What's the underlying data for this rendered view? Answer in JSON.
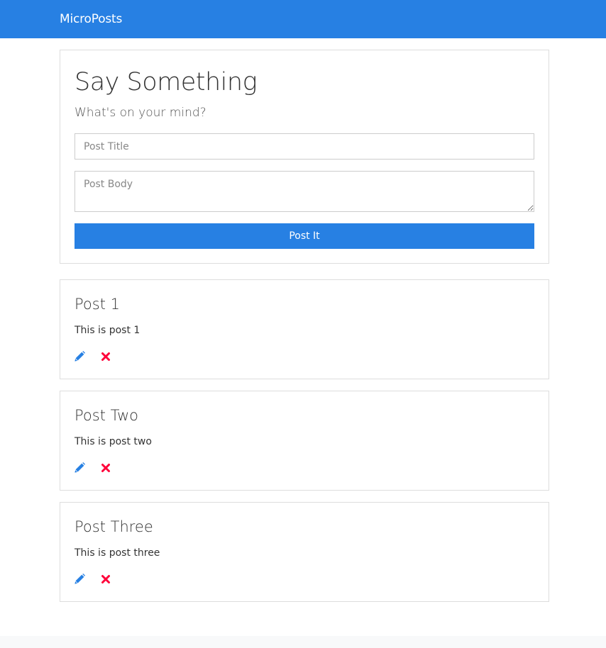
{
  "navbar": {
    "brand": "MicroPosts"
  },
  "form": {
    "heading": "Say Something",
    "lead": "What's on your mind?",
    "title_placeholder": "Post Title",
    "title_value": "",
    "body_placeholder": "Post Body",
    "body_value": "",
    "submit_label": "Post It"
  },
  "posts": [
    {
      "title": "Post 1",
      "body": "This is post 1",
      "edit_icon": "pencil-icon",
      "delete_icon": "close-icon"
    },
    {
      "title": "Post Two",
      "body": "This is post two",
      "edit_icon": "pencil-icon",
      "delete_icon": "close-icon"
    },
    {
      "title": "Post Three",
      "body": "This is post three",
      "edit_icon": "pencil-icon",
      "delete_icon": "close-icon"
    }
  ],
  "colors": {
    "primary": "#2780e3",
    "danger": "#ff0039",
    "border": "#dddddd"
  }
}
